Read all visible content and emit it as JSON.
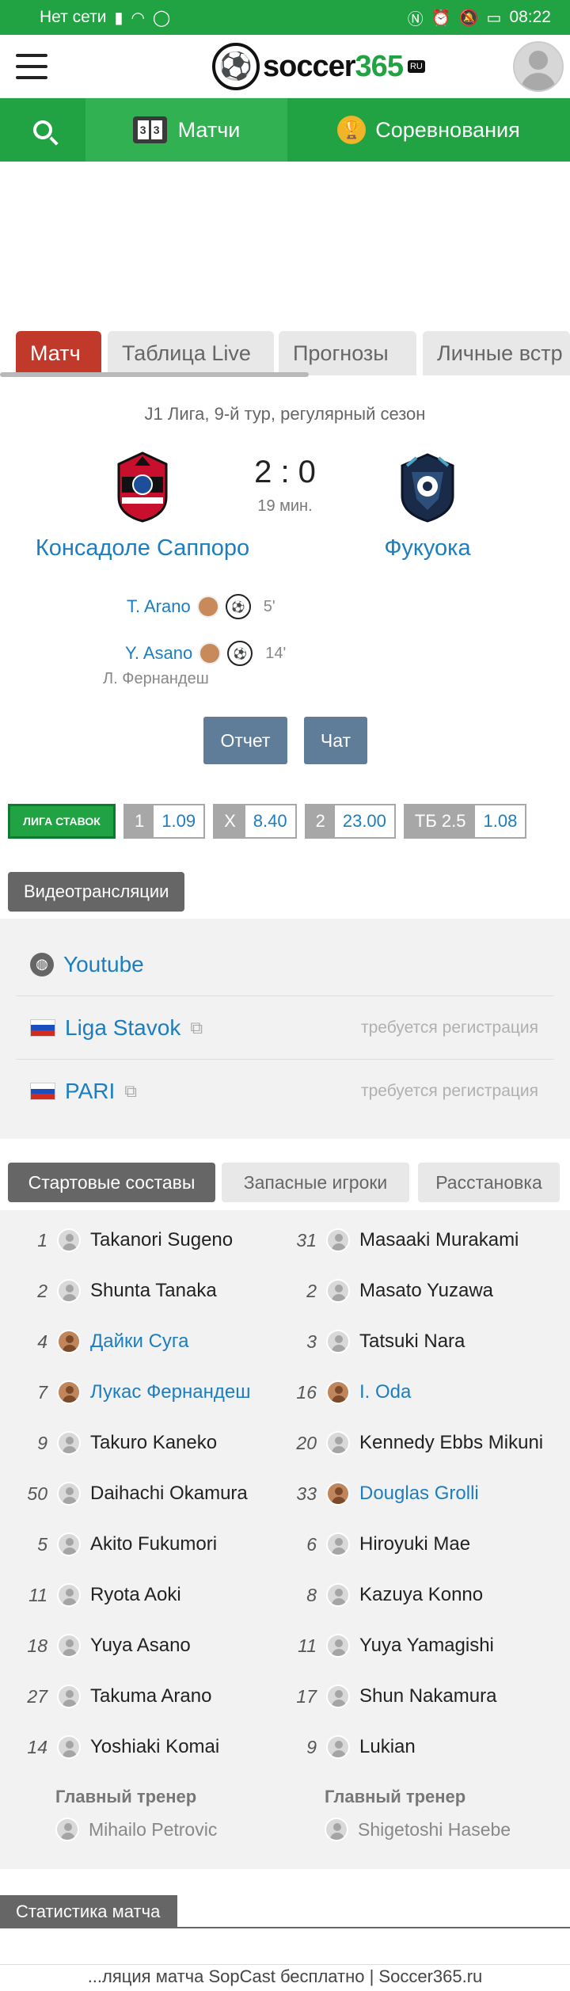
{
  "status_bar": {
    "network": "Нет сети",
    "time": "08:22"
  },
  "logo": {
    "text_a": "soccer",
    "text_b": "365",
    "ru": "RU"
  },
  "nav": {
    "matches": "Матчи",
    "competitions": "Соревнования",
    "score_icon": [
      "3",
      "3"
    ]
  },
  "tabs": [
    "Матч",
    "Таблица Live",
    "Прогнозы",
    "Личные встр"
  ],
  "match": {
    "league": "J1 Лига, 9-й тур, регулярный сезон",
    "home": "Консадоле Саппоро",
    "away": "Фукуока",
    "score": "2 : 0",
    "minute": "19 мин.",
    "goals": [
      {
        "scorer": "T. Arano",
        "minute": "5'"
      },
      {
        "scorer": "Y. Asano",
        "minute": "14'"
      }
    ],
    "assist": "Л. Фернандеш",
    "report_btn": "Отчет",
    "chat_btn": "Чат"
  },
  "odds": {
    "bookmaker": "ЛИГА СТАВОК",
    "items": [
      {
        "label": "1",
        "value": "1.09"
      },
      {
        "label": "X",
        "value": "8.40"
      },
      {
        "label": "2",
        "value": "23.00"
      },
      {
        "label": "ТБ 2.5",
        "value": "1.08"
      }
    ]
  },
  "video": {
    "title": "Видеотрансляции",
    "items": [
      {
        "name": "Youtube",
        "note": ""
      },
      {
        "name": "Liga Stavok",
        "note": "требуется регистрация"
      },
      {
        "name": "PARI",
        "note": "требуется регистрация"
      }
    ]
  },
  "lineups": {
    "tabs": [
      "Стартовые составы",
      "Запасные игроки",
      "Расстановка"
    ],
    "home": [
      {
        "num": "1",
        "name": "Takanori Sugeno"
      },
      {
        "num": "2",
        "name": "Shunta Tanaka"
      },
      {
        "num": "4",
        "name": "Дайки Суга"
      },
      {
        "num": "7",
        "name": "Лукас Фернандеш"
      },
      {
        "num": "9",
        "name": "Takuro Kaneko"
      },
      {
        "num": "50",
        "name": "Daihachi Okamura"
      },
      {
        "num": "5",
        "name": "Akito Fukumori"
      },
      {
        "num": "11",
        "name": "Ryota Aoki"
      },
      {
        "num": "18",
        "name": "Yuya Asano"
      },
      {
        "num": "27",
        "name": "Takuma Arano"
      },
      {
        "num": "14",
        "name": "Yoshiaki Komai"
      }
    ],
    "away": [
      {
        "num": "31",
        "name": "Masaaki Murakami"
      },
      {
        "num": "2",
        "name": "Masato Yuzawa"
      },
      {
        "num": "3",
        "name": "Tatsuki Nara"
      },
      {
        "num": "16",
        "name": "I. Oda"
      },
      {
        "num": "20",
        "name": "Kennedy Ebbs Mikuni"
      },
      {
        "num": "33",
        "name": "Douglas Grolli"
      },
      {
        "num": "6",
        "name": "Hiroyuki Mae"
      },
      {
        "num": "8",
        "name": "Kazuya Konno"
      },
      {
        "num": "11",
        "name": "Yuya Yamagishi"
      },
      {
        "num": "17",
        "name": "Shun Nakamura"
      },
      {
        "num": "9",
        "name": "Lukian"
      }
    ],
    "coach_label": "Главный тренер",
    "home_coach": "Mihailo Petrovic",
    "away_coach": "Shigetoshi Hasebe"
  },
  "stats": {
    "title": "Статистика матча"
  },
  "footer": "...ляция матча SopCast бесплатно | Soccer365.ru"
}
